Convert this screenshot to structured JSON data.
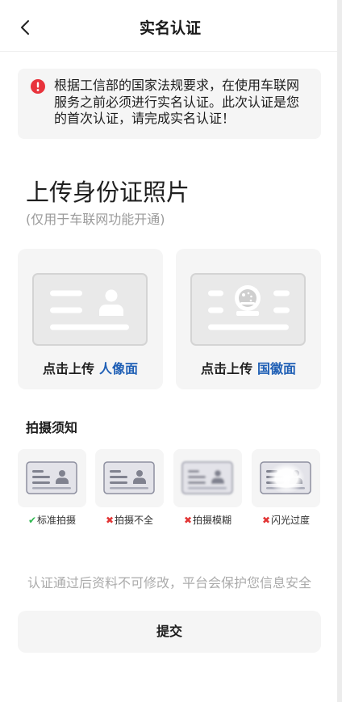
{
  "header": {
    "back_icon": "chevron-left-icon",
    "title": "实名认证"
  },
  "notice": {
    "icon": "alert-circle-icon",
    "text": "根据工信部的国家法规要求，在使用车联网服务之前必须进行实名认证。此次认证是您的首次认证，请完成实名认证！"
  },
  "upload": {
    "title": "上传身份证照片",
    "subtitle": "(仅用于车联网功能开通)",
    "cards": [
      {
        "action": "点击上传",
        "side": "人像面",
        "illustration": "id-card-portrait-side-icon"
      },
      {
        "action": "点击上传",
        "side": "国徽面",
        "illustration": "id-card-emblem-side-icon"
      }
    ]
  },
  "tips": {
    "title": "拍摄须知",
    "items": [
      {
        "mark": "✔",
        "label": "标准拍摄",
        "mark_color": "#2eb84f",
        "example": "id-card-standard-icon"
      },
      {
        "mark": "✖",
        "label": "拍摄不全",
        "mark_color": "#e23535",
        "example": "id-card-incomplete-icon"
      },
      {
        "mark": "✖",
        "label": "拍摄模糊",
        "mark_color": "#e23535",
        "example": "id-card-blurry-icon"
      },
      {
        "mark": "✖",
        "label": "闪光过度",
        "mark_color": "#e23535",
        "example": "id-card-glare-icon"
      }
    ]
  },
  "footer_note": "认证通过后资料不可修改，平台会保护您信息安全",
  "submit": {
    "label": "提交"
  },
  "colors": {
    "accent_blue": "#1f5fb5",
    "alert_red": "#e8333c",
    "text_primary": "#1f1f1f",
    "text_muted": "#9b9b9b",
    "card_background": "#f5f5f5"
  }
}
